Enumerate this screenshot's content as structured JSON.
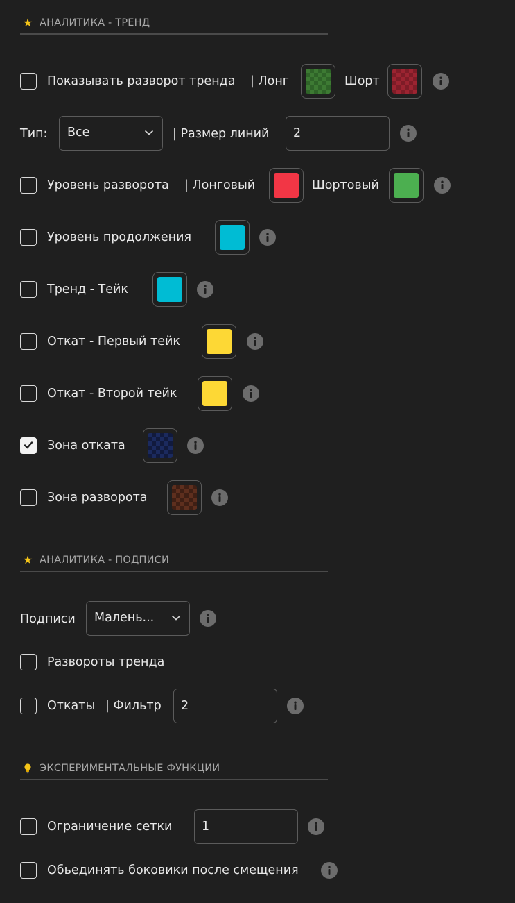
{
  "sections": {
    "trend": {
      "icon": "star-icon",
      "title": "АНАЛИТИКА - ТРЕНД"
    },
    "labels": {
      "icon": "star-icon",
      "title": "АНАЛИТИКА - ПОДПИСИ"
    },
    "experimental": {
      "icon": "lightbulb-icon",
      "title": "ЭКСПЕРИМЕНТАЛЬНЫЕ ФУНКЦИИ"
    }
  },
  "colors": {
    "background": "#1f1f1f",
    "long_swatch": "#3d7a33",
    "short_swatch": "#9c2431",
    "reversal_long": "#f23645",
    "reversal_short": "#4caf50",
    "cyan": "#00bcd4",
    "yellow": "#fdd835",
    "pullback_zone": "#1b2a5e",
    "reversal_zone": "#5e2f1e"
  },
  "rows": {
    "show_reversal": {
      "checked": false,
      "label": "Показывать разворот тренда",
      "long_label": "| Лонг",
      "short_label": "Шорт"
    },
    "type": {
      "label": "Тип:",
      "select_value": "Все",
      "line_size_label": "| Размер линий",
      "line_size_value": "2"
    },
    "reversal_level": {
      "checked": false,
      "label": "Уровень разворота",
      "long_label": "| Лонговый",
      "short_label": "Шортовый"
    },
    "continuation_level": {
      "checked": false,
      "label": "Уровень продолжения"
    },
    "trend_take": {
      "checked": false,
      "label": "Тренд - Тейк"
    },
    "pullback_first": {
      "checked": false,
      "label": "Откат - Первый тейк"
    },
    "pullback_second": {
      "checked": false,
      "label": "Откат - Второй тейк"
    },
    "pullback_zone": {
      "checked": true,
      "label": "Зона отката"
    },
    "reversal_zone": {
      "checked": false,
      "label": "Зона разворота"
    },
    "captions": {
      "label": "Подписи",
      "select_value": "Малень..."
    },
    "trend_reversals": {
      "checked": false,
      "label": "Развороты тренда"
    },
    "pullbacks": {
      "checked": false,
      "label": "Откаты",
      "filter_label": "| Фильтр",
      "filter_value": "2"
    },
    "grid_limit": {
      "checked": false,
      "label": "Ограничение сетки",
      "value": "1"
    },
    "merge_sideways": {
      "checked": false,
      "label": "Обьединять боковики после смещения"
    }
  }
}
